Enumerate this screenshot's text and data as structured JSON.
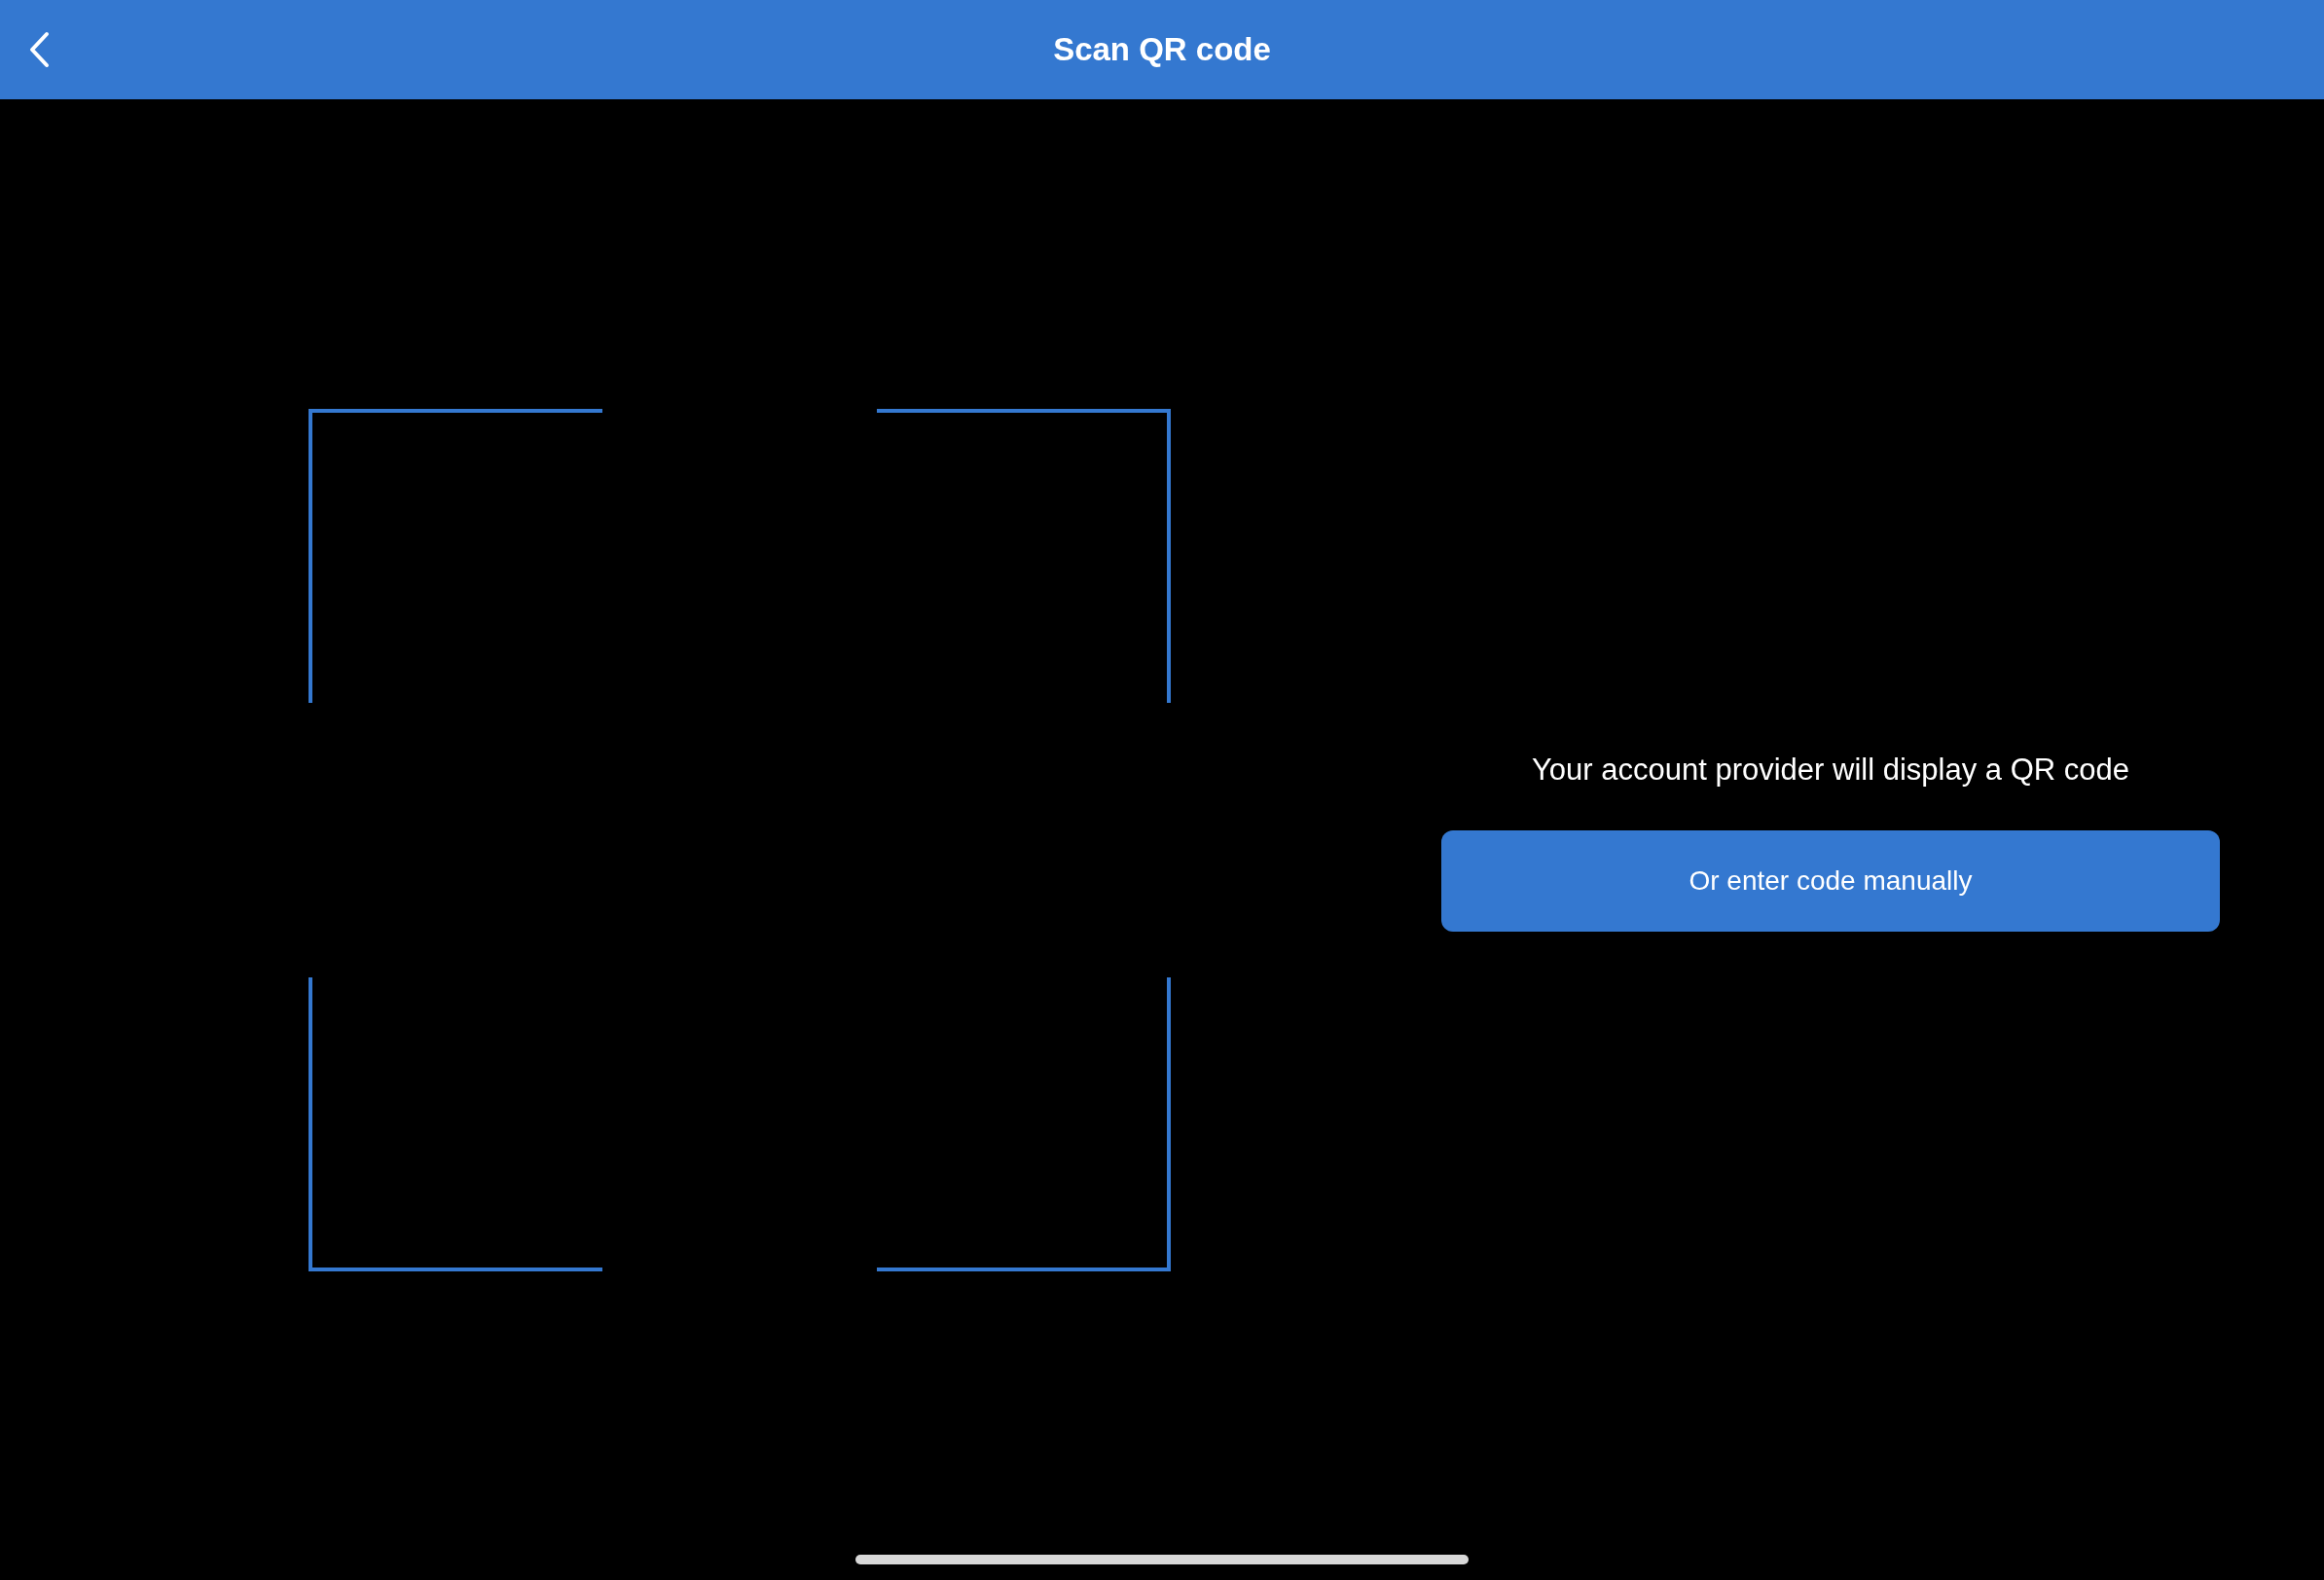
{
  "header": {
    "title": "Scan QR code"
  },
  "prompt": "Your account provider will display a QR code",
  "manual_button": {
    "label": "Or enter code manually"
  }
}
